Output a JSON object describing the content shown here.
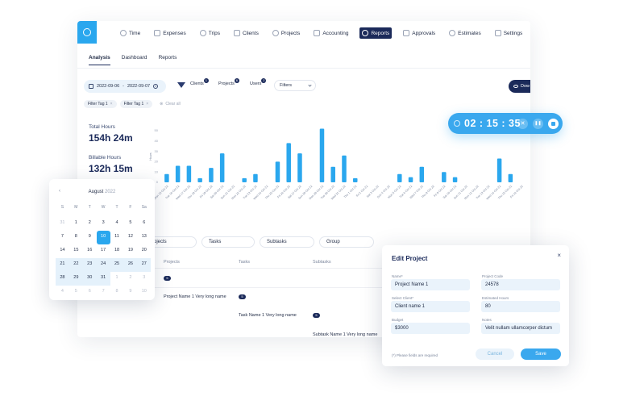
{
  "nav": {
    "items": [
      {
        "label": "Time",
        "icon": "clock-icon",
        "active": false
      },
      {
        "label": "Expenses",
        "icon": "receipt-icon",
        "active": false
      },
      {
        "label": "Trips",
        "icon": "trip-icon",
        "active": false
      },
      {
        "label": "Clients",
        "icon": "client-icon",
        "active": false
      },
      {
        "label": "Projects",
        "icon": "folder-icon",
        "active": false
      },
      {
        "label": "Accounting",
        "icon": "accounting-icon",
        "active": false
      },
      {
        "label": "Reports",
        "icon": "chart-icon",
        "active": true
      },
      {
        "label": "Approvals",
        "icon": "check-icon",
        "active": false
      },
      {
        "label": "Estimates",
        "icon": "estimate-icon",
        "active": false
      },
      {
        "label": "Settings",
        "icon": "gear-icon",
        "active": false
      }
    ]
  },
  "subtabs": [
    "Analysis",
    "Dashboard",
    "Reports"
  ],
  "filterbar": {
    "date_from": "2022-09-06",
    "date_sep": "-",
    "date_to": "2022-09-07",
    "clients_label": "Clients",
    "clients_count": "1",
    "projects_label": "Projects",
    "projects_count": "6",
    "users_label": "Users",
    "users_count": "2",
    "filters_label": "Filters",
    "download_label": "Dow"
  },
  "tags": {
    "tag1": "Filter Tag 1",
    "tag2": "Filter Tag 1",
    "clear_label": "Clear all"
  },
  "stats": {
    "total_label": "Total Hours",
    "total_value": "154h 24m",
    "billable_label": "Billable Hours",
    "billable_value": "132h 15m"
  },
  "chart_data": {
    "type": "bar",
    "ylabel": "Hours",
    "yticks": [
      "50",
      "40",
      "30",
      "20",
      "10",
      "0"
    ],
    "ylim": [
      0,
      50
    ],
    "categories": [
      "Mon 15 Oct 22",
      "Tue 16 Oct 22",
      "Wed 17 Oct 22",
      "Thu 18 Oct 22",
      "Fri 19 Oct 22",
      "Sat 20 Oct 22",
      "Sun 21 Oct 22",
      "Mon 22 Oct 22",
      "Tue 23 Oct 22",
      "Wed 24 Oct 22",
      "Thu 25 Oct 22",
      "Fri 26 Oct 22",
      "Sat 27 Oct 22",
      "Sun 28 Oct 22",
      "Mon 29 Oct 22",
      "Tue 30 Oct 22",
      "Wed 31 Oct 22",
      "Thu 1 Oct 22",
      "Fri 2 Oct 22",
      "Sat 3 Oct 22",
      "Sun 4 Oct 22",
      "Mon 5 Oct 22",
      "Tue 6 Oct 22",
      "Wed 7 Oct 22",
      "Thu 8 Oct 22",
      "Fri 9 Oct 22",
      "Sat 10 Oct 22",
      "Sun 11 Oct 22",
      "Mon 12 Oct 22",
      "Tue 13 Oct 22",
      "Wed 14 Oct 22",
      "Thu 15 Oct 22",
      "Fri 16 Oct 22"
    ],
    "values": [
      8,
      16,
      16,
      4,
      14,
      28,
      0,
      4,
      8,
      0,
      20,
      38,
      28,
      0,
      52,
      15,
      26,
      4,
      0,
      0,
      0,
      8,
      5,
      15,
      0,
      10,
      5,
      0,
      0,
      0,
      23,
      8,
      0
    ],
    "bar_color": "#2aa7ee",
    "grid": false
  },
  "table": {
    "dropdowns": [
      "Projects",
      "Tasks",
      "Subtasks",
      "Group"
    ],
    "headers": [
      "Projects",
      "Tasks",
      "Subtasks"
    ],
    "project_row": "Project Name 1 Very long name",
    "task_row": "Task Name 1 Very long name",
    "subtask_row": "Subtask Name 1 Very long name",
    "badge": "5"
  },
  "calendar": {
    "prev": "‹",
    "month": "August",
    "year": "2022",
    "weekdays": [
      "S",
      "M",
      "T",
      "W",
      "T",
      "F",
      "Sa"
    ],
    "days": [
      {
        "d": "31",
        "m": true
      },
      {
        "d": "1"
      },
      {
        "d": "2"
      },
      {
        "d": "3"
      },
      {
        "d": "4"
      },
      {
        "d": "5"
      },
      {
        "d": "6"
      },
      {
        "d": "7"
      },
      {
        "d": "8"
      },
      {
        "d": "9"
      },
      {
        "d": "10",
        "sel": true
      },
      {
        "d": "11"
      },
      {
        "d": "12"
      },
      {
        "d": "13"
      },
      {
        "d": "14"
      },
      {
        "d": "15"
      },
      {
        "d": "16"
      },
      {
        "d": "17"
      },
      {
        "d": "18"
      },
      {
        "d": "19"
      },
      {
        "d": "20"
      },
      {
        "d": "21",
        "b": true
      },
      {
        "d": "22",
        "b": true
      },
      {
        "d": "23",
        "b": true
      },
      {
        "d": "24",
        "b": true
      },
      {
        "d": "25",
        "b": true
      },
      {
        "d": "26",
        "b": true
      },
      {
        "d": "27",
        "b": true
      },
      {
        "d": "28",
        "b": true
      },
      {
        "d": "29",
        "b": true
      },
      {
        "d": "30",
        "b": true
      },
      {
        "d": "31",
        "b": true
      },
      {
        "d": "1",
        "m": true
      },
      {
        "d": "2",
        "m": true
      },
      {
        "d": "3",
        "m": true
      },
      {
        "d": "4",
        "m": true
      },
      {
        "d": "5",
        "m": true
      },
      {
        "d": "6",
        "m": true
      },
      {
        "d": "7",
        "m": true
      },
      {
        "d": "8",
        "m": true
      },
      {
        "d": "9",
        "m": true
      },
      {
        "d": "10",
        "m": true
      }
    ]
  },
  "timer": {
    "time": "02 : 15 : 35",
    "close": "✕",
    "pause": "❚❚"
  },
  "edit_project": {
    "title": "Edit Project",
    "close": "×",
    "name_label": "Name*",
    "name_value": "Project Name 1",
    "code_label": "Project Code",
    "code_value": "24578",
    "client_label": "Select Client*",
    "client_value": "Client name 1",
    "hours_label": "Estimated Hours",
    "hours_value": "80",
    "budget_label": "Budget",
    "budget_value": "$3000",
    "notes_label": "Notes",
    "notes_value": "Velit nullam ullamcorper dictum",
    "required_note": "(*) Please fields are required",
    "cancel_label": "Cancel",
    "save_label": "Save"
  }
}
